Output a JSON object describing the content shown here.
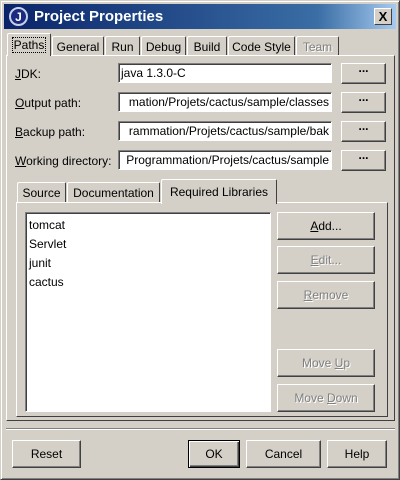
{
  "window": {
    "title": "Project Properties",
    "icon_letter": "J",
    "close_glyph": "X"
  },
  "tabs": [
    {
      "label": "Paths",
      "active": true
    },
    {
      "label": "General"
    },
    {
      "label": "Run"
    },
    {
      "label": "Debug"
    },
    {
      "label": "Build"
    },
    {
      "label": "Code Style"
    },
    {
      "label": "Team",
      "disabled": true
    }
  ],
  "form": {
    "jdk": {
      "mnemonic": "J",
      "rest": "DK:",
      "value": "java 1.3.0-C"
    },
    "output": {
      "mnemonic": "O",
      "rest": "utput path:",
      "value": "mation/Projets/cactus/sample/classes"
    },
    "backup": {
      "mnemonic": "B",
      "rest": "ackup path:",
      "value": "rammation/Projets/cactus/sample/bak"
    },
    "working": {
      "mnemonic": "W",
      "rest": "orking directory:",
      "value": "Programmation/Projets/cactus/sample"
    },
    "browse_label": "..."
  },
  "inner_tabs": [
    {
      "label": "Source"
    },
    {
      "label": "Documentation"
    },
    {
      "label": "Required Libraries",
      "active": true
    }
  ],
  "libraries": [
    "tomcat",
    "Servlet",
    "junit",
    "cactus"
  ],
  "side_buttons": {
    "add": {
      "mnemonic": "A",
      "rest": "dd..."
    },
    "edit": {
      "mnemonic": "E",
      "rest": "dit..."
    },
    "remove": {
      "mnemonic": "R",
      "rest": "emove"
    },
    "move_up": {
      "pre": "Move ",
      "mnemonic": "U",
      "rest": "p"
    },
    "move_down": {
      "pre": "Move ",
      "mnemonic": "D",
      "rest": "own"
    }
  },
  "bottom_buttons": {
    "reset": "Reset",
    "ok": "OK",
    "cancel": "Cancel",
    "help": "Help"
  },
  "colors": {
    "titlebar_start": "#0a246a",
    "titlebar_end": "#a6caf0",
    "face": "#d4d0c8"
  }
}
